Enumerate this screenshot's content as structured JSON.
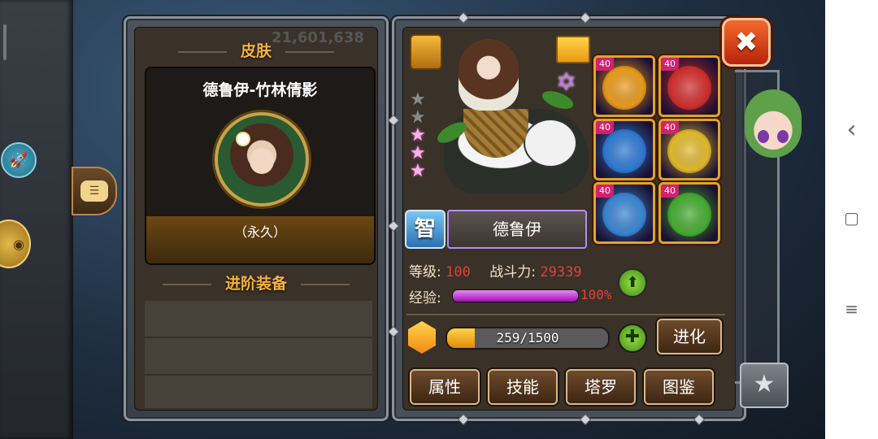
{
  "skin_panel": {
    "title": "皮肤",
    "bg_number": "21,601,638",
    "skin_name": "德鲁伊-竹林倩影",
    "duration": "（永久）",
    "advanced_title": "进阶装备"
  },
  "hero": {
    "attribute_badge": "智",
    "name": "德鲁伊",
    "stars_total": 5,
    "stars_lit": 3,
    "level_label": "等级:",
    "level": "100",
    "power_label": "战斗力:",
    "power": "29339",
    "exp_label": "经验:",
    "exp_percent": "100%",
    "exp_fraction": 1.0,
    "fragments": "259/1500",
    "fragments_fraction": 0.17,
    "evolve_label": "进化"
  },
  "equipment": [
    {
      "level": "40",
      "color": "#f2a018"
    },
    {
      "level": "40",
      "color": "#d8302a"
    },
    {
      "level": "40",
      "color": "#2f7fd8"
    },
    {
      "level": "40",
      "color": "#e8c02a"
    },
    {
      "level": "40",
      "color": "#3a8ad8"
    },
    {
      "level": "40",
      "color": "#48b22e"
    }
  ],
  "tabs": {
    "attributes": "属性",
    "skills": "技能",
    "tarot": "塔罗",
    "codex": "图鉴"
  },
  "icons": {
    "close": "✖",
    "upgrade": "⬆",
    "plus": "✚",
    "favorite": "★",
    "nav_back": "‹",
    "nav_home": "▢",
    "nav_menu": "≡"
  },
  "colors": {
    "title_orange": "#f6b43a",
    "number_red": "#e0423c",
    "exp_purple": "#c040d8",
    "fragment_gold": "#f0a818"
  }
}
